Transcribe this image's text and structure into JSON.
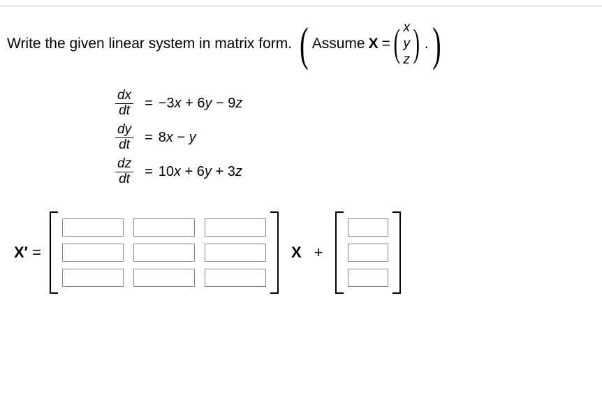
{
  "prompt": {
    "text1": "Write the given linear system in matrix form.",
    "assume": "Assume",
    "X": "X",
    "equals": "=",
    "vec": [
      "x",
      "y",
      "z"
    ],
    "period": "."
  },
  "equations": [
    {
      "num": "dx",
      "den": "dt",
      "eq": "=",
      "rhs_parts": [
        "−3",
        "x",
        " + 6",
        "y",
        " − 9",
        "z"
      ]
    },
    {
      "num": "dy",
      "den": "dt",
      "eq": "=",
      "rhs_parts": [
        "8",
        "x",
        " − ",
        "y"
      ]
    },
    {
      "num": "dz",
      "den": "dt",
      "eq": "=",
      "rhs_parts": [
        "10",
        "x",
        " + 6",
        "y",
        " + 3",
        "z"
      ]
    }
  ],
  "matrixform": {
    "xprime": "X′",
    "equals": "=",
    "X": "X",
    "plus": "+"
  },
  "chart_data": {
    "type": "table",
    "title": "Linear system in matrix form X' = AX + f",
    "matrix_A_rows": 3,
    "matrix_A_cols": 3,
    "matrix_A": [
      [
        "",
        "",
        ""
      ],
      [
        "",
        "",
        ""
      ],
      [
        "",
        "",
        ""
      ]
    ],
    "vector_f_rows": 3,
    "vector_f": [
      "",
      "",
      ""
    ]
  }
}
